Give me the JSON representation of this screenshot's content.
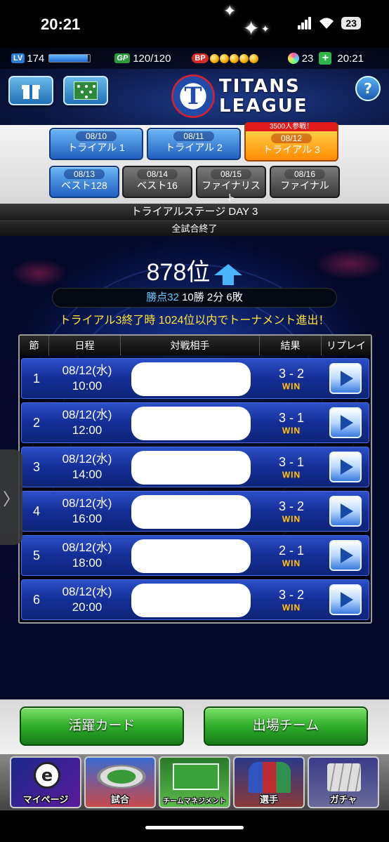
{
  "status_bar": {
    "time": "20:21",
    "battery": "23"
  },
  "game_header": {
    "level_tag": "LV",
    "level": "174",
    "xp_progress": 0.95,
    "gp_tag": "GP",
    "gp": "120/120",
    "bp_tag": "BP",
    "bp_count": 5,
    "coins": "23",
    "stamina_time": "20:21",
    "logo_letter": "T",
    "logo_line1": "TITANS",
    "logo_line2": "LEAGUE",
    "help_label": "?"
  },
  "tabs": [
    {
      "date": "08/10",
      "label": "トライアル 1",
      "state": "blue"
    },
    {
      "date": "08/11",
      "label": "トライアル 2",
      "state": "blue"
    },
    {
      "date": "08/12",
      "label": "トライアル 3",
      "state": "active",
      "badge": "3500人参戦！"
    },
    {
      "date": "08/13",
      "label": "ベスト128",
      "state": "blue"
    },
    {
      "date": "08/14",
      "label": "ベスト16",
      "state": "gray"
    },
    {
      "date": "08/15",
      "label": "ファイナリスト",
      "state": "gray"
    },
    {
      "date": "08/16",
      "label": "ファイナル",
      "state": "gray"
    }
  ],
  "stage": {
    "title": "トライアルステージ DAY 3",
    "status": "全試合終了"
  },
  "rank": {
    "value": "878位"
  },
  "record": {
    "points": "勝点32",
    "summary": "10勝 2分 6敗"
  },
  "notice": "トライアル3終了時 1024位以内でトーナメント進出！",
  "table": {
    "headers": {
      "no": "節",
      "date": "日程",
      "opponent": "対戦相手",
      "result": "結果",
      "replay": "リプレイ"
    },
    "rows": [
      {
        "no": "1",
        "date": "08/12(水)",
        "time": "10:00",
        "score": "3 - 2",
        "outcome": "WIN"
      },
      {
        "no": "2",
        "date": "08/12(水)",
        "time": "12:00",
        "score": "3 - 1",
        "outcome": "WIN"
      },
      {
        "no": "3",
        "date": "08/12(水)",
        "time": "14:00",
        "score": "3 - 1",
        "outcome": "WIN"
      },
      {
        "no": "4",
        "date": "08/12(水)",
        "time": "16:00",
        "score": "3 - 2",
        "outcome": "WIN"
      },
      {
        "no": "5",
        "date": "08/12(水)",
        "time": "18:00",
        "score": "2 - 1",
        "outcome": "WIN"
      },
      {
        "no": "6",
        "date": "08/12(水)",
        "time": "20:00",
        "score": "3 - 2",
        "outcome": "WIN"
      }
    ]
  },
  "side_handle": "〉",
  "buttons": {
    "card": "活躍カード",
    "team": "出場チーム"
  },
  "nav": [
    {
      "label": "マイページ",
      "emblem": "e"
    },
    {
      "label": "試合"
    },
    {
      "label": "チームマネジメント"
    },
    {
      "label": "選手"
    },
    {
      "label": "ガチャ"
    }
  ]
}
